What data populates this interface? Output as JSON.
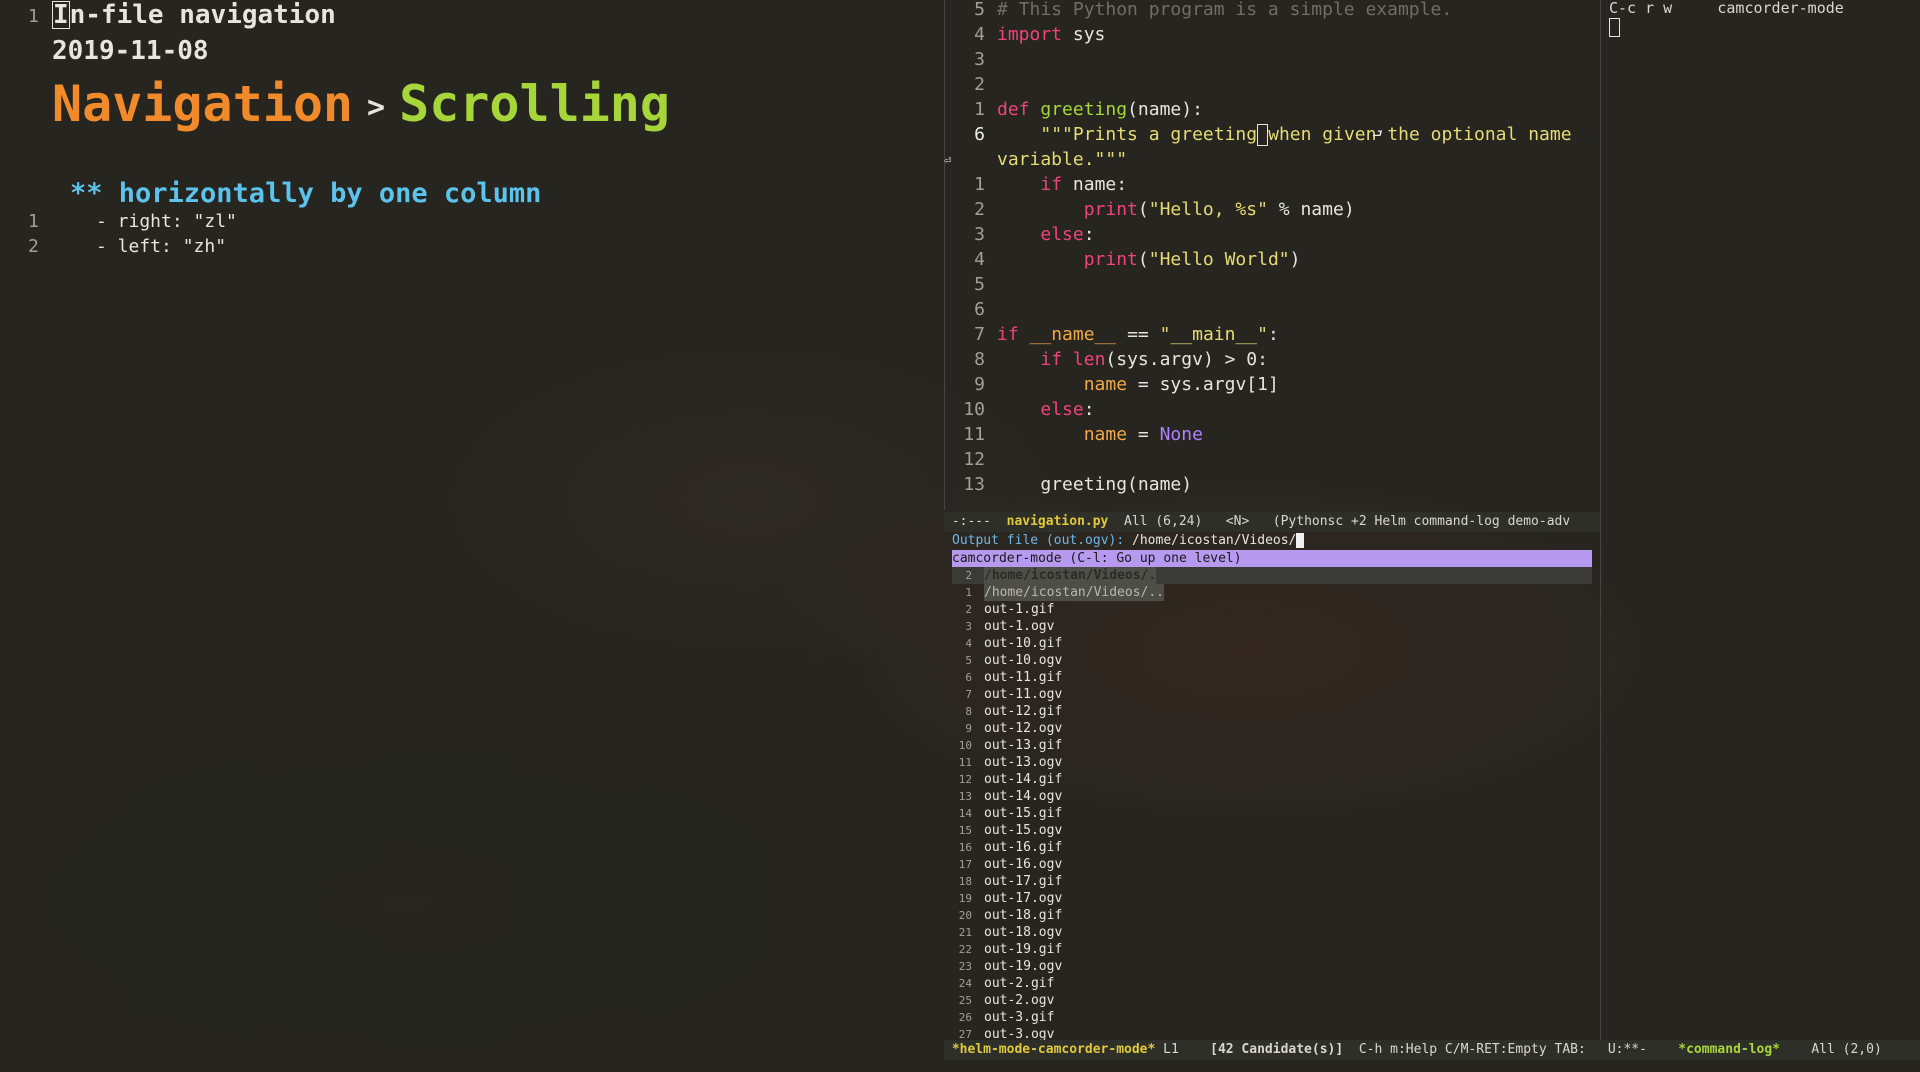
{
  "org": {
    "title": "In-file navigation",
    "title_first_char": "I",
    "title_rest": "n-file navigation",
    "date": "2019-11-08",
    "line_numbers": [
      "1",
      "1",
      "2"
    ],
    "breadcrumb": {
      "parent": "Navigation",
      "separator": ">",
      "current": "Scrolling"
    },
    "heading": "** horizontally by one column",
    "items": [
      "- right: \"zl\"",
      "- left: \"zh\""
    ]
  },
  "python": {
    "lines": [
      {
        "n": "5",
        "html": "<span class='cm'># This Python program is a simple example.</span>"
      },
      {
        "n": "4",
        "html": "<span class='kw'>import</span> <span class='df'>sys</span>"
      },
      {
        "n": "3",
        "html": ""
      },
      {
        "n": "2",
        "html": ""
      },
      {
        "n": "1",
        "html": "<span class='kw'>def</span> <span class='fn'>greeting</span><span class='df'>(name):</span>"
      },
      {
        "n": "6",
        "cur": true,
        "html": "    <span class='st'>\"\"\"Prints a greeting<span class='cursor-inline'></span>when given the optional name</span>"
      },
      {
        "n": "",
        "html": "<span class='st'>variable.\"\"\"</span>"
      },
      {
        "n": "1",
        "html": "    <span class='kw'>if</span> <span class='df'>name:</span>"
      },
      {
        "n": "2",
        "html": "        <span class='kw'>print</span><span class='df'>(</span><span class='st'>\"Hello, %s\"</span> <span class='df'>% name)</span>"
      },
      {
        "n": "3",
        "html": "    <span class='kw'>else</span><span class='df'>:</span>"
      },
      {
        "n": "4",
        "html": "        <span class='kw'>print</span><span class='df'>(</span><span class='st'>\"Hello World\"</span><span class='df'>)</span>"
      },
      {
        "n": "5",
        "html": ""
      },
      {
        "n": "6",
        "html": ""
      },
      {
        "n": "7",
        "html": "<span class='kw'>if</span> <span class='vr'>__name__</span> <span class='df'>==</span> <span class='st'>\"__main__\"</span><span class='df'>:</span>"
      },
      {
        "n": "8",
        "html": "    <span class='kw'>if</span> <span class='kw'>len</span><span class='df'>(sys.argv) &gt; 0:</span>"
      },
      {
        "n": "9",
        "html": "        <span class='vr'>name</span> <span class='df'>= sys.argv[1]</span>"
      },
      {
        "n": "10",
        "html": "    <span class='kw'>else</span><span class='df'>:</span>"
      },
      {
        "n": "11",
        "html": "        <span class='vr'>name</span> <span class='df'>=</span> <span class='cn'>None</span>"
      },
      {
        "n": "12",
        "html": ""
      },
      {
        "n": "13",
        "html": "    <span class='df'>greeting(name)</span>"
      }
    ],
    "modeline": {
      "state": "-:---",
      "buffer": "navigation.py",
      "position": "All (6,24)",
      "evil": "<N>",
      "modes": "(Pythonsc +2 Helm command-log demo-adv"
    }
  },
  "helm": {
    "prompt_label": "Output file (out.ogv): ",
    "prompt_value": "/home/icostan/Videos/",
    "header": "camcorder-mode (C-l: Go up one level)",
    "candidates": [
      {
        "i": "2",
        "name": "/home/icostan/Videos/.",
        "kind": "sel"
      },
      {
        "i": "1",
        "name": "/home/icostan/Videos/..",
        "kind": "dir"
      },
      {
        "i": "2",
        "name": "out-1.gif"
      },
      {
        "i": "3",
        "name": "out-1.ogv"
      },
      {
        "i": "4",
        "name": "out-10.gif"
      },
      {
        "i": "5",
        "name": "out-10.ogv"
      },
      {
        "i": "6",
        "name": "out-11.gif"
      },
      {
        "i": "7",
        "name": "out-11.ogv"
      },
      {
        "i": "8",
        "name": "out-12.gif"
      },
      {
        "i": "9",
        "name": "out-12.ogv"
      },
      {
        "i": "10",
        "name": "out-13.gif"
      },
      {
        "i": "11",
        "name": "out-13.ogv"
      },
      {
        "i": "12",
        "name": "out-14.gif"
      },
      {
        "i": "13",
        "name": "out-14.ogv"
      },
      {
        "i": "14",
        "name": "out-15.gif"
      },
      {
        "i": "15",
        "name": "out-15.ogv"
      },
      {
        "i": "16",
        "name": "out-16.gif"
      },
      {
        "i": "17",
        "name": "out-16.ogv"
      },
      {
        "i": "18",
        "name": "out-17.gif"
      },
      {
        "i": "19",
        "name": "out-17.ogv"
      },
      {
        "i": "20",
        "name": "out-18.gif"
      },
      {
        "i": "21",
        "name": "out-18.ogv"
      },
      {
        "i": "22",
        "name": "out-19.gif"
      },
      {
        "i": "23",
        "name": "out-19.ogv"
      },
      {
        "i": "24",
        "name": "out-2.gif"
      },
      {
        "i": "25",
        "name": "out-2.ogv"
      },
      {
        "i": "26",
        "name": "out-3.gif"
      },
      {
        "i": "27",
        "name": "out-3.ogv"
      }
    ],
    "modeline": {
      "buffer": "*helm-mode-camcorder-mode*",
      "line": "L1",
      "count": "[42 Candidate(s)]",
      "hints": "C-h m:Help C/M-RET:Empty TAB:"
    }
  },
  "command_log": {
    "key": "C-c r w",
    "command": "camcorder-mode",
    "modeline": {
      "state": "U:**-",
      "buffer": "*command-log*",
      "position": "All (2,0)"
    }
  }
}
